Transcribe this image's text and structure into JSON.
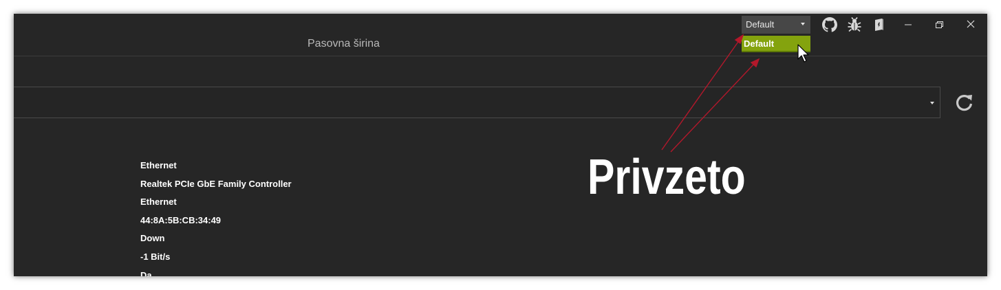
{
  "titlebar": {
    "page_title": "Pasovna širina",
    "theme_selected": "Default",
    "theme_options": [
      "Default"
    ],
    "icons": [
      "github-icon",
      "bug-icon",
      "book-icon"
    ],
    "window_buttons": [
      "minimize-icon",
      "restore-icon",
      "close-icon"
    ]
  },
  "adapter_select": {
    "value": ""
  },
  "adapter_info": [
    "Ethernet",
    "Realtek PCIe GbE Family Controller",
    "Ethernet",
    "44:8A:5B:CB:34:49",
    "Down",
    "-1 Bit/s",
    "Da"
  ],
  "annotation": {
    "text": "Privzeto",
    "arrow_color": "#b3182b"
  },
  "colors": {
    "accent": "#84a30e",
    "background": "#262626"
  }
}
